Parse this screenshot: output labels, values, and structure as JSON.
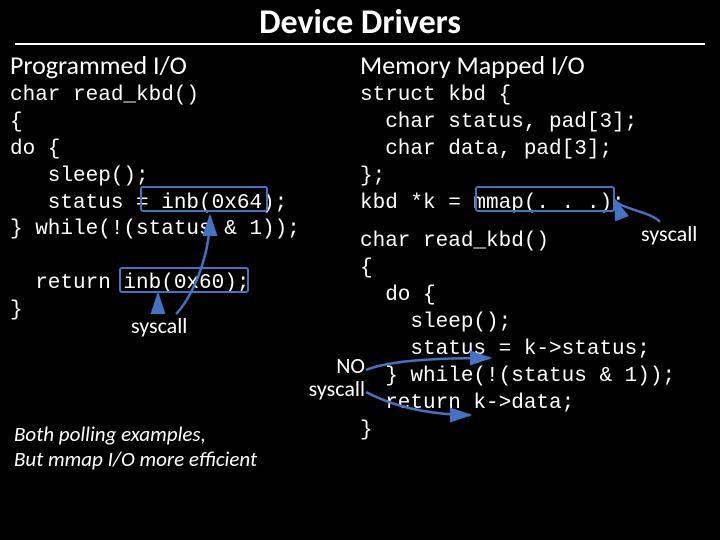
{
  "title": "Device Drivers",
  "left": {
    "heading": "Programmed I/O",
    "code": "char read_kbd()\n{\ndo {\n   sleep();\n   status = inb(0x64);\n} while(!(status & 1));\n\n  return inb(0x60);\n}",
    "annot_syscall": "syscall"
  },
  "right": {
    "heading": "Memory Mapped I/O",
    "code_top": "struct kbd {\n  char status, pad[3];\n  char data, pad[3];\n};\nkbd *k = mmap(. . .);",
    "code_bottom": "char read_kbd()\n{\n  do {\n    sleep();\n    status = k->status;\n  } while(!(status & 1));\n  return k->data;\n}",
    "annot_syscall": "syscall",
    "annot_no_syscall_line1": "NO",
    "annot_no_syscall_line2": "syscall"
  },
  "note_line1": "Both polling examples,",
  "note_line2": "But mmap I/O more efficient"
}
